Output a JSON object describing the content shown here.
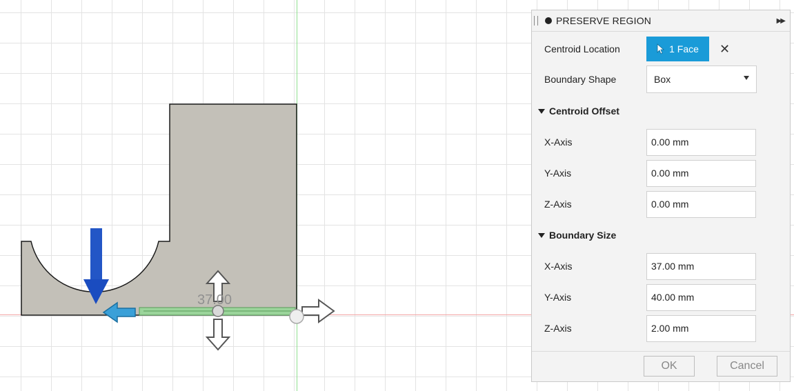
{
  "viewport": {
    "dimension_label": "37.00"
  },
  "panel": {
    "title": "PRESERVE REGION",
    "icons": [
      "grip-icon",
      "dot-icon",
      "expand-icon",
      "cursor-icon",
      "close-icon"
    ],
    "centroid_location": {
      "label": "Centroid Location",
      "button_label": "1 Face",
      "clear_symbol": "✕"
    },
    "boundary_shape": {
      "label": "Boundary Shape",
      "value": "Box"
    },
    "centroid_offset": {
      "header": "Centroid Offset",
      "x": {
        "label": "X-Axis",
        "value": "0.00 mm"
      },
      "y": {
        "label": "Y-Axis",
        "value": "0.00 mm"
      },
      "z": {
        "label": "Z-Axis",
        "value": "0.00 mm"
      }
    },
    "boundary_size": {
      "header": "Boundary Size",
      "x": {
        "label": "X-Axis",
        "value": "37.00 mm"
      },
      "y": {
        "label": "Y-Axis",
        "value": "40.00 mm"
      },
      "z": {
        "label": "Z-Axis",
        "value": "2.00 mm"
      }
    },
    "ok_label": "OK",
    "cancel_label": "Cancel"
  },
  "colors": {
    "accent": "#1a9bd8",
    "part_fill": "#c3c0b8",
    "load_arrow": "#1f4fc4",
    "manipulator_blue": "#3aa0d8",
    "manipulator_green": "#90d090"
  }
}
